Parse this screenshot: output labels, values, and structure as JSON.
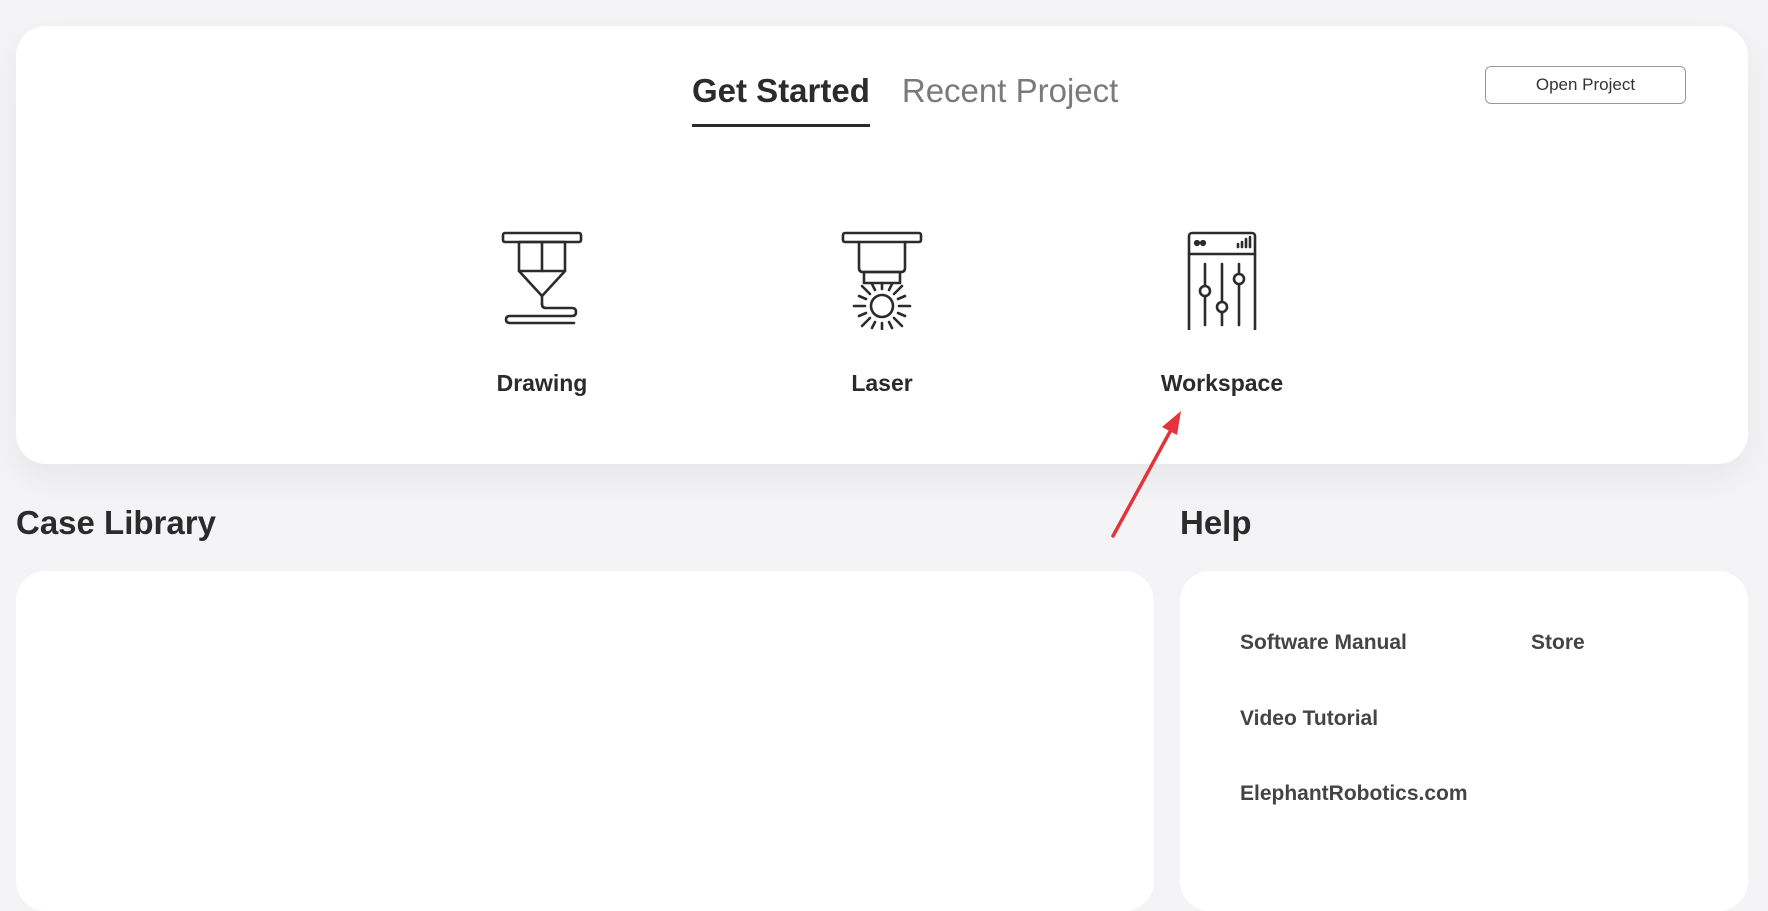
{
  "get_started": {
    "tabs": [
      {
        "label": "Get Started",
        "active": true
      },
      {
        "label": "Recent Project",
        "active": false
      }
    ],
    "open_project_label": "Open Project",
    "modes": [
      {
        "label": "Drawing",
        "icon": "pen-plotter-icon"
      },
      {
        "label": "Laser",
        "icon": "laser-head-icon"
      },
      {
        "label": "Workspace",
        "icon": "control-panel-icon"
      }
    ]
  },
  "case_library": {
    "title": "Case Library"
  },
  "help": {
    "title": "Help",
    "links": [
      {
        "label": "Software Manual"
      },
      {
        "label": "Store"
      },
      {
        "label": "Video Tutorial"
      },
      {
        "label": "ElephantRobotics.com"
      }
    ]
  },
  "colors": {
    "background": "#f4f4f6",
    "card": "#ffffff",
    "text": "#2b2b2b",
    "inactive_tab": "#7a7a7a",
    "annotation_arrow": "#e2343a"
  }
}
